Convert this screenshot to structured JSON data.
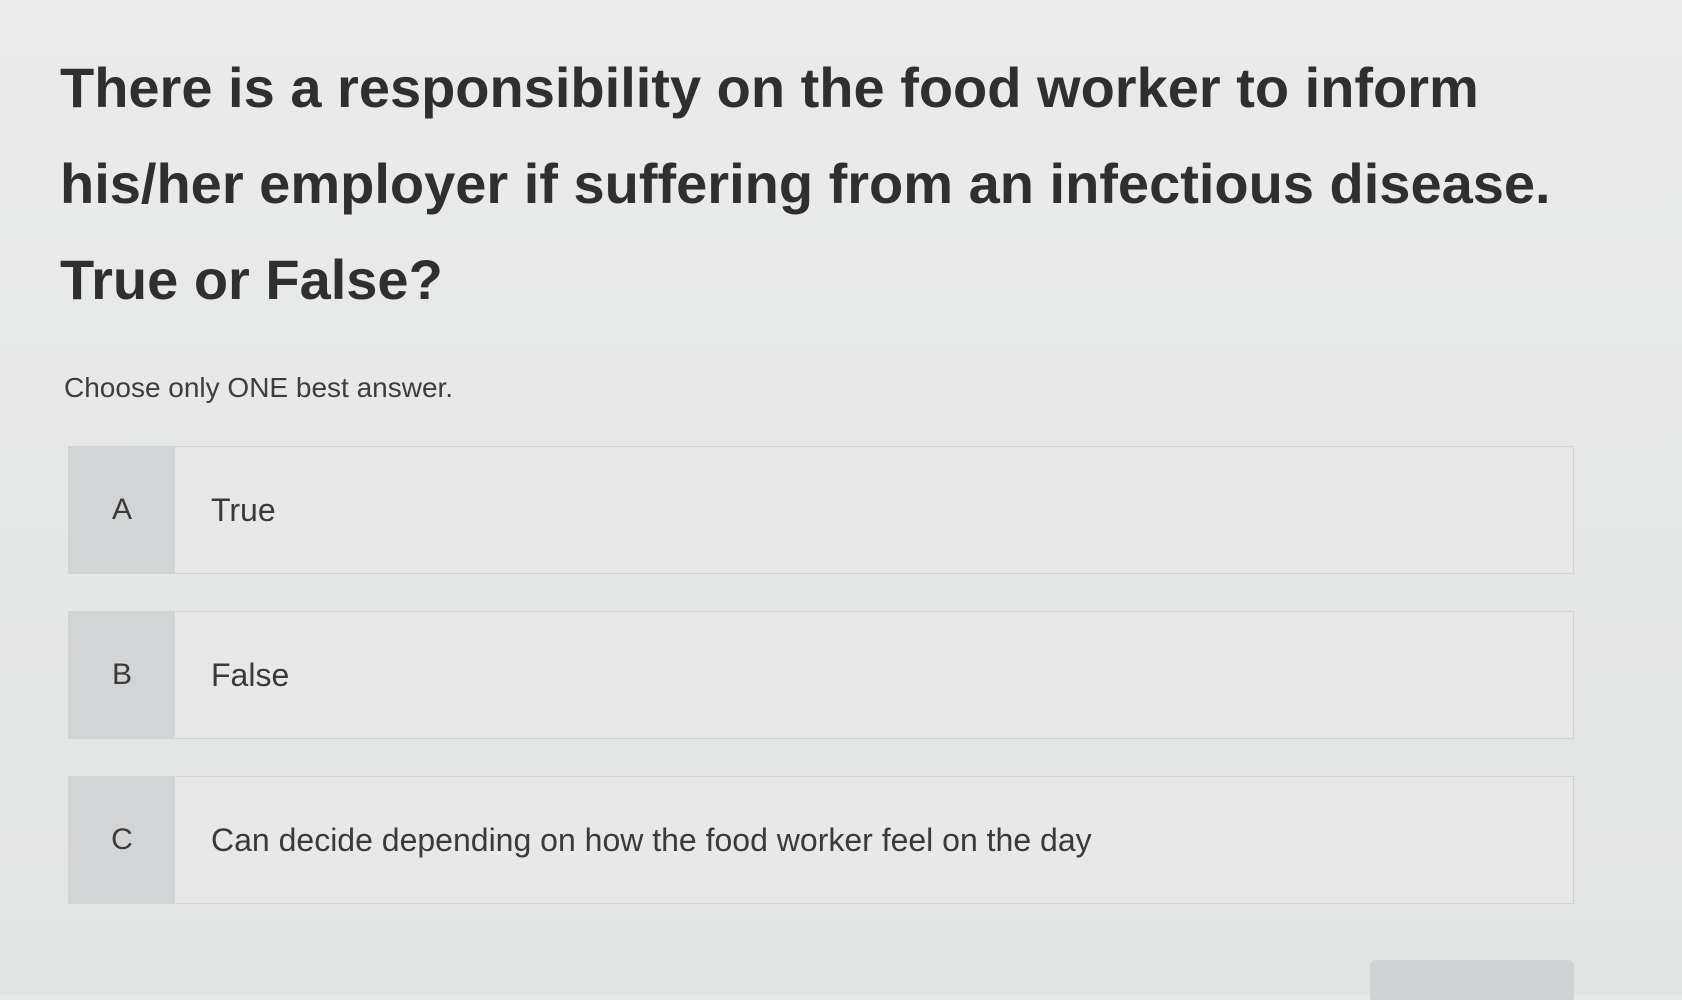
{
  "question": {
    "text": "There is a responsibility on the food worker to inform his/her employer if suffering from an infectious disease. True or False?"
  },
  "instruction": "Choose only ONE best answer.",
  "options": [
    {
      "letter": "A",
      "label": "True"
    },
    {
      "letter": "B",
      "label": "False"
    },
    {
      "letter": "C",
      "label": "Can decide depending on how the food worker feel on the day"
    }
  ]
}
